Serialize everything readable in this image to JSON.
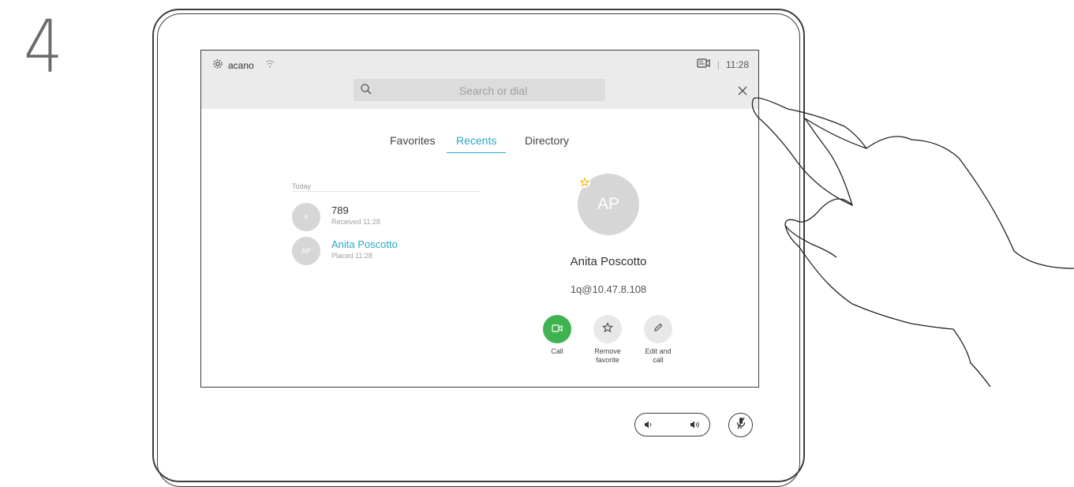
{
  "step": {
    "number": "4"
  },
  "status_bar": {
    "system_name": "acano",
    "time": "11:28",
    "icons": [
      "gear-icon",
      "wifi-icon",
      "camera-self-view-icon"
    ]
  },
  "search": {
    "placeholder": "Search or dial",
    "value": ""
  },
  "tabs": [
    {
      "label": "Favorites",
      "active": false
    },
    {
      "label": "Recents",
      "active": true
    },
    {
      "label": "Directory",
      "active": false
    }
  ],
  "recents": {
    "section_label": "Today",
    "items": [
      {
        "initials": "#",
        "name": "789",
        "detail": "Received 11:28",
        "highlighted": false
      },
      {
        "initials": "AP",
        "name": "Anita Poscotto",
        "detail": "Placed 11:28",
        "highlighted": true
      }
    ]
  },
  "detail": {
    "initials": "AP",
    "name": "Anita Poscotto",
    "address": "1q@10.47.8.108",
    "favorite": true
  },
  "actions": [
    {
      "label_line1": "Call",
      "label_line2": ""
    },
    {
      "label_line1": "Remove",
      "label_line2": "favorite"
    },
    {
      "label_line1": "Edit and",
      "label_line2": "call"
    }
  ],
  "colors": {
    "accent": "#27a9c7",
    "call_green": "#3fb34f",
    "star_yellow": "#f2b705",
    "topbar_bg": "#ebebeb"
  }
}
